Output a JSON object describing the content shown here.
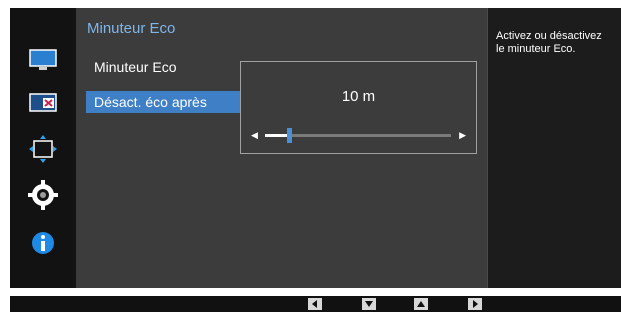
{
  "menu": {
    "title": "Minuteur Eco",
    "items": [
      {
        "label": "Minuteur Eco"
      },
      {
        "label": "Désact. éco après"
      }
    ]
  },
  "value_panel": {
    "value": "10 m",
    "slider_fraction": 0.13
  },
  "help": {
    "line1": "Activez ou désactivez",
    "line2": "le minuteur Eco."
  },
  "sidebar": {
    "icons": [
      "picture-icon",
      "pip-icon",
      "size-position-icon",
      "system-gear-icon",
      "info-icon"
    ]
  },
  "nav": {
    "buttons": [
      "left-arrow-icon",
      "down-arrow-icon",
      "up-arrow-icon",
      "right-arrow-icon"
    ]
  },
  "colors": {
    "accent": "#3e7fc6",
    "title": "#7fb6ea",
    "panel": "#3c3c3c",
    "sidebar": "#121212"
  }
}
